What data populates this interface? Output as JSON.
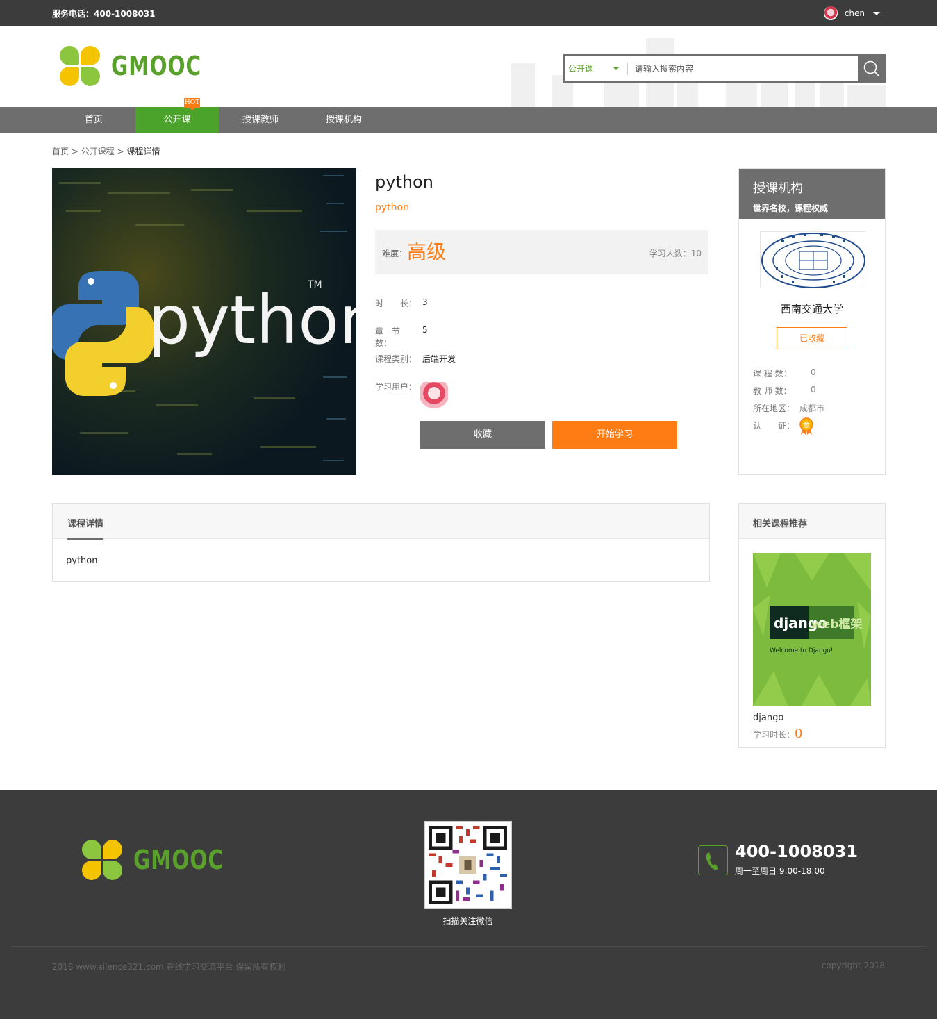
{
  "topbar": {
    "phone_label": "服务电话：",
    "phone": "400-1008031",
    "username": "chen"
  },
  "header": {
    "logo_text": "GMOOC",
    "search": {
      "category": "公开课",
      "placeholder": "请输入搜索内容"
    }
  },
  "nav": {
    "items": [
      {
        "label": "首页"
      },
      {
        "label": "公开课",
        "active": true
      },
      {
        "label": "授课教师"
      },
      {
        "label": "授课机构"
      }
    ],
    "hot_badge": "HOT"
  },
  "breadcrumb": {
    "home": "首页",
    "sep": ">",
    "section": "公开课程",
    "current": "课程详情"
  },
  "course": {
    "image_text": "python",
    "image_tm": "TM",
    "title": "python",
    "subtitle": "python",
    "difficulty_label": "难度：",
    "difficulty": "高级",
    "learners_label": "学习人数：",
    "learners": "10",
    "duration_label": "时　　长：",
    "duration": "3",
    "chapters_label": "章　节　数：",
    "chapters": "5",
    "category_label": "课程类别：",
    "category": "后端开发",
    "users_label": "学习用户：",
    "fav_button": "收藏",
    "start_button": "开始学习"
  },
  "org": {
    "header_title": "授课机构",
    "header_sub": "世界名校，课程权威",
    "name": "西南交通大学",
    "collected_button": "已收藏",
    "course_count_label": "课 程 数：",
    "course_count": "0",
    "teacher_count_label": "教 师 数：",
    "teacher_count": "0",
    "region_label": "所在地区：",
    "region": "成都市",
    "cert_label": "认　　证：",
    "cert_badge": "金"
  },
  "detail": {
    "tab": "课程详情",
    "content": "python"
  },
  "related": {
    "title": "相关课程推荐",
    "thumb_text1": "django",
    "thumb_text2": "web框架",
    "thumb_text3": "Welcome to Django!",
    "course_name": "django",
    "time_label": "学习时长：",
    "time_value": "0"
  },
  "footer": {
    "logo_text": "GMOOC",
    "qr_caption": "扫描关注微信",
    "phone": "400-1008031",
    "hours": "周一至周日 9:00-18:00",
    "copyright_left": "2018 www.silence321.com 在线学习交流平台 保留所有权利",
    "copyright_right": "copyright 2018"
  },
  "colors": {
    "brand_green": "#4ca32c",
    "accent_orange": "#ff7c14",
    "dark_bar": "#3c3c3c",
    "nav_gray": "#6e6e6e"
  }
}
